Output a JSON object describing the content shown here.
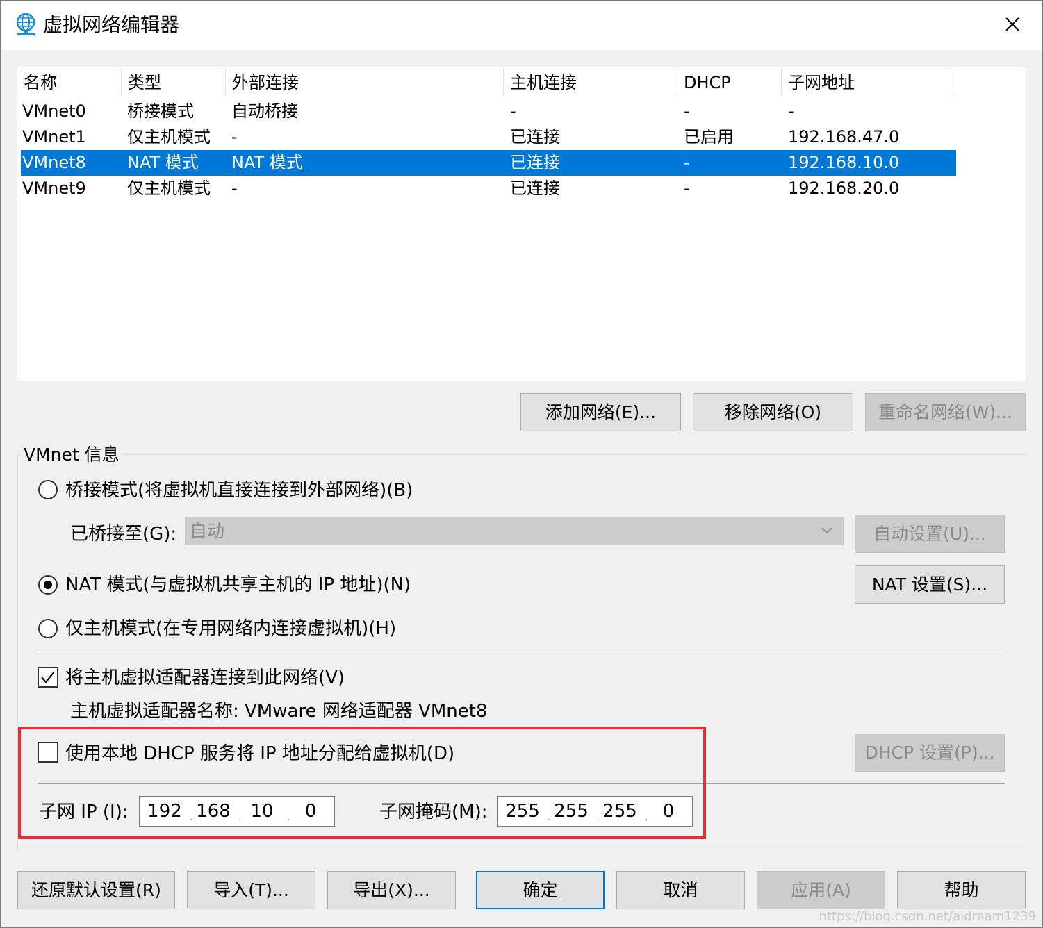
{
  "window": {
    "title": "虚拟网络编辑器",
    "icon": "globe-network-icon",
    "close_icon": "close-icon"
  },
  "network_list": {
    "columns": [
      "名称",
      "类型",
      "外部连接",
      "主机连接",
      "DHCP",
      "子网地址"
    ],
    "rows": [
      {
        "name": "VMnet0",
        "type": "桥接模式",
        "external": "自动桥接",
        "host": "-",
        "dhcp": "-",
        "subnet": "-"
      },
      {
        "name": "VMnet1",
        "type": "仅主机模式",
        "external": "-",
        "host": "已连接",
        "dhcp": "已启用",
        "subnet": "192.168.47.0"
      },
      {
        "name": "VMnet8",
        "type": "NAT 模式",
        "external": "NAT 模式",
        "host": "已连接",
        "dhcp": "-",
        "subnet": "192.168.10.0"
      },
      {
        "name": "VMnet9",
        "type": "仅主机模式",
        "external": "-",
        "host": "已连接",
        "dhcp": "-",
        "subnet": "192.168.20.0"
      }
    ],
    "selected_row": "VMnet8"
  },
  "list_buttons": {
    "add": "添加网络(E)...",
    "remove": "移除网络(O)",
    "rename": "重命名网络(W)..."
  },
  "vmnet_info": {
    "group_title": "VMnet 信息",
    "bridged_label": "桥接模式(将虚拟机直接连接到外部网络)(B)",
    "bridged_to_label": "已桥接至(G):",
    "bridged_to_value": "自动",
    "auto_settings_button": "自动设置(U)...",
    "nat_label": "NAT 模式(与虚拟机共享主机的 IP 地址)(N)",
    "nat_settings_button": "NAT 设置(S)...",
    "hostonly_label": "仅主机模式(在专用网络内连接虚拟机)(H)",
    "selected_mode": "nat",
    "connect_adapter_label": "将主机虚拟适配器连接到此网络(V)",
    "connect_adapter_checked": true,
    "adapter_name_label": "主机虚拟适配器名称: VMware 网络适配器 VMnet8",
    "dhcp_label": "使用本地 DHCP 服务将 IP 地址分配给虚拟机(D)",
    "dhcp_checked": false,
    "dhcp_settings_button": "DHCP 设置(P)...",
    "subnet_ip_label": "子网 IP (I):",
    "subnet_ip": [
      "192",
      "168",
      "10",
      "0"
    ],
    "subnet_mask_label": "子网掩码(M):",
    "subnet_mask": [
      "255",
      "255",
      "255",
      "0"
    ]
  },
  "footer_buttons": {
    "restore": "还原默认设置(R)",
    "import": "导入(T)...",
    "export": "导出(X)...",
    "ok": "确定",
    "cancel": "取消",
    "apply": "应用(A)",
    "help": "帮助"
  },
  "watermark": "https://blog.csdn.net/aidream1239",
  "colors": {
    "selection": "#0078d7",
    "highlight_box": "#ea2b36",
    "disabled_text": "#8a8a8a"
  }
}
